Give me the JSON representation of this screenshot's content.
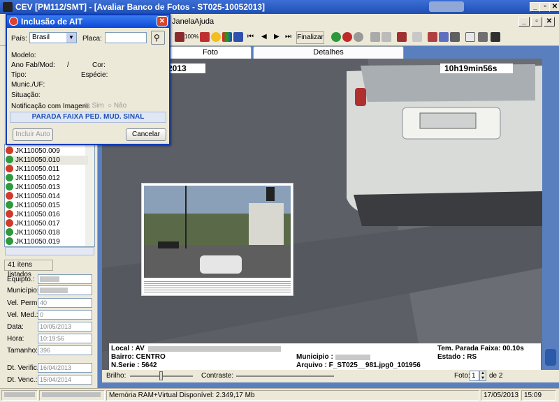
{
  "window": {
    "title": "CEV [PM112/SMT] - [Avaliar Banco de Fotos - ST025-10052013]"
  },
  "menubar": {
    "items": [
      "Janela",
      "Ajuda"
    ]
  },
  "toolbar": {
    "finalize_label": "Finalizar",
    "zoom_label": "100%"
  },
  "dialog": {
    "title": "Inclusão de AIT",
    "pais_label": "País:",
    "pais_value": "Brasil",
    "placa_label": "Placa:",
    "placa_value": "",
    "modelo_label": "Modelo:",
    "ano_label": "Ano Fab/Mod:",
    "ano_sep": "/",
    "cor_label": "Cor:",
    "tipo_label": "Tipo:",
    "especie_label": "Espécie:",
    "munic_label": "Munic./UF:",
    "situacao_label": "Situação:",
    "notif_label": "Notificação com Imagem:",
    "sim_label": "Sim",
    "nao_label": "Não",
    "infraction": "PARADA FAIXA PED. MUD. SINAL",
    "incluir_label": "Incluir Auto",
    "cancelar_label": "Cancelar"
  },
  "list": {
    "items": [
      {
        "code": "JK110050.009",
        "status": "red"
      },
      {
        "code": "JK110050.010",
        "status": "green"
      },
      {
        "code": "JK110050.011",
        "status": "red"
      },
      {
        "code": "JK110050.012",
        "status": "green"
      },
      {
        "code": "JK110050.013",
        "status": "green"
      },
      {
        "code": "JK110050.014",
        "status": "red"
      },
      {
        "code": "JK110050.015",
        "status": "green"
      },
      {
        "code": "JK110050.016",
        "status": "red"
      },
      {
        "code": "JK110050.017",
        "status": "red"
      },
      {
        "code": "JK110050.018",
        "status": "green"
      },
      {
        "code": "JK110050.019",
        "status": "green"
      }
    ],
    "count": "41 itens listados"
  },
  "fields": {
    "equipto_label": "Equipto.:",
    "municipio_label": "Município:",
    "velperm_label": "Vel. Perm.:",
    "velperm_value": "40",
    "velmed_label": "Vel. Med.:",
    "velmed_value": "0",
    "data_label": "Data:",
    "data_value": "10/05/2013",
    "hora_label": "Hora:",
    "hora_value": "10:19:56",
    "tamanho_label": "Tamanho:",
    "tamanho_value": "396",
    "dtverif_label": "Dt. Verific.:",
    "dtverif_value": "16/04/2013",
    "dtvenc_label": "Dt. Venc.:",
    "dtvenc_value": "15/04/2014"
  },
  "tabs": [
    "Foto",
    "Detalhes"
  ],
  "photo": {
    "date_overlay": "2013",
    "time_overlay": "10h19min56s"
  },
  "info": {
    "local_label": "Local : AV",
    "bairro": "Bairro: CENTRO",
    "nserie": "N.Serie : 5642",
    "municipio_label": "Municipio :",
    "arquivo": "Arquivo : F_ST025__981.jpg0_101956",
    "tempo": "Tem. Parada Faixa: 00.10s",
    "estado": "Estado : RS"
  },
  "bottombar": {
    "brilho_label": "Brilho:",
    "contraste_label": "Contraste:",
    "foto_label": "Foto:",
    "foto_value": "1",
    "foto_total": "de 2"
  },
  "statusbar": {
    "memory": "Memória RAM+Virtual Disponível: 2.349,17 Mb",
    "date": "17/05/2013",
    "time": "15:09"
  }
}
